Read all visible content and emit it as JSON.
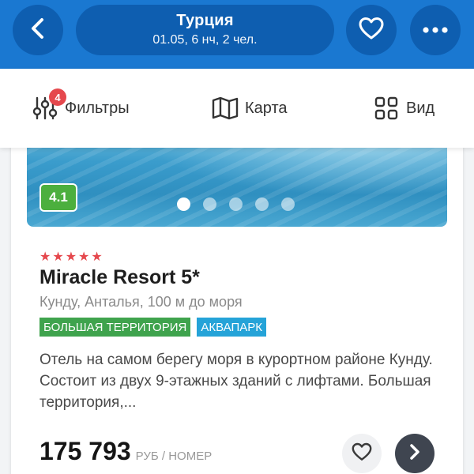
{
  "header": {
    "title": "Турция",
    "subtitle": "01.05, 6 нч, 2 чел.",
    "back_icon": "chevron-left-icon",
    "favorite_icon": "heart-icon",
    "more_icon": "more-dots-icon"
  },
  "toolbar": {
    "filters_label": "Фильтры",
    "filters_count": "4",
    "map_label": "Карта",
    "view_label": "Вид"
  },
  "hotel": {
    "rating": "4.1",
    "photo_count": 5,
    "active_photo_index": 0,
    "stars": "★★★★★",
    "star_count": 5,
    "name": "Miracle Resort 5*",
    "location": "Кунду, Анталья, 100 м до моря",
    "tags": [
      "БОЛЬШАЯ ТЕРРИТОРИЯ",
      "АКВАПАРК"
    ],
    "description": "Отель на самом берегу моря в курортном районе Кунду. Состоит из двух 9-этажных зданий с лифтами. Большая территория,...",
    "price": "175 793",
    "price_unit": "РУБ / НОМЕР"
  },
  "colors": {
    "primary": "#1a78d1",
    "primary_dark": "#0e5eb0",
    "rating_green": "#4caf3e",
    "tag_green": "#3fa34d",
    "tag_blue": "#25a3d8",
    "star_red": "#e5484d"
  }
}
